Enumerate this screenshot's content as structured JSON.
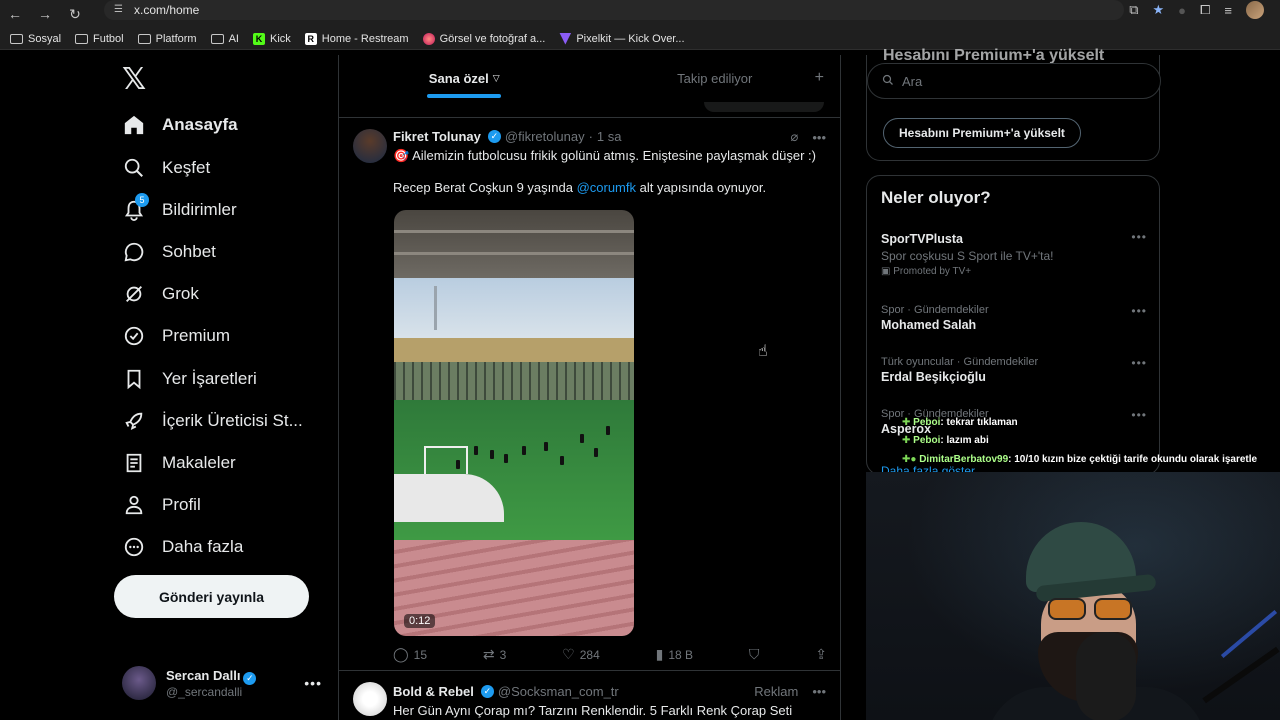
{
  "browser": {
    "url": "x.com/home",
    "bookmarks": [
      "Sosyal",
      "Futbol",
      "Platform",
      "AI",
      "Kick",
      "Home - Restream",
      "Görsel ve fotoğraf a...",
      "Pixelkit — Kick Over..."
    ]
  },
  "nav": {
    "items": [
      {
        "label": "Anasayfa",
        "icon": "home-icon"
      },
      {
        "label": "Keşfet",
        "icon": "search-icon"
      },
      {
        "label": "Bildirimler",
        "icon": "bell-icon",
        "badge": "5"
      },
      {
        "label": "Sohbet",
        "icon": "chat-icon"
      },
      {
        "label": "Grok",
        "icon": "grok-icon"
      },
      {
        "label": "Premium",
        "icon": "premium-icon"
      },
      {
        "label": "Yer İşaretleri",
        "icon": "bookmark-icon"
      },
      {
        "label": "İçerik Üreticisi St...",
        "icon": "rocket-icon"
      },
      {
        "label": "Makaleler",
        "icon": "article-icon"
      },
      {
        "label": "Profil",
        "icon": "profile-icon"
      },
      {
        "label": "Daha fazla",
        "icon": "more-circle-icon"
      }
    ],
    "post_button": "Gönderi yayınla",
    "profile": {
      "name": "Sercan Dallı",
      "handle": "@_sercandalli"
    }
  },
  "tabs": {
    "for_you": "Sana özel",
    "following": "Takip ediliyor"
  },
  "tweets": [
    {
      "name": "Fikret Tolunay",
      "handle": "@fikretolunay",
      "time": "1 sa",
      "line1": "🎯 Ailemizin futbolcusu frikik golünü atmış. Eniştesine paylaşmak düşer :)",
      "line2_pre": "Recep Berat Coşkun 9 yaşında ",
      "line2_link": "@corumfk",
      "line2_post": " alt yapısında oynuyor.",
      "video_duration": "0:12",
      "replies": "15",
      "retweets": "3",
      "likes": "284",
      "views": "18 B"
    },
    {
      "name": "Bold & Rebel",
      "handle": "@Socksman_com_tr",
      "tag": "Reklam",
      "text": "Her Gün Aynı Çorap mı? Tarzını Renklendir. 5 Farklı Renk Çorap Seti"
    }
  ],
  "right": {
    "premium_title": "Hesabını Premium+'a yükselt",
    "search_placeholder": "Ara",
    "premium_button": "Hesabını Premium+'a yükselt",
    "trends_title": "Neler oluyor?",
    "trends": [
      {
        "title": "SporTVPlusta",
        "sub": "Spor coşkusu S Sport ile TV+'ta!",
        "promo": "Promoted by TV+"
      },
      {
        "context": "Spor · Gündemdekiler",
        "title": "Mohamed Salah"
      },
      {
        "context": "Türk oyuncular · Gündemdekiler",
        "title": "Erdal Beşikçioğlu"
      },
      {
        "context": "Spor · Gündemdekiler",
        "title": "Asperox"
      }
    ],
    "show_more": "Daha fazla göster"
  },
  "chat": [
    {
      "user": "Peboi",
      "msg": ": tekrar tıklaman"
    },
    {
      "user": "Peboi",
      "msg": ": lazım abi"
    },
    {
      "user": "DimitarBerbatov99",
      "msg": ": 10/10 kızın bize çektiği tarife okundu olarak işaretle"
    }
  ]
}
